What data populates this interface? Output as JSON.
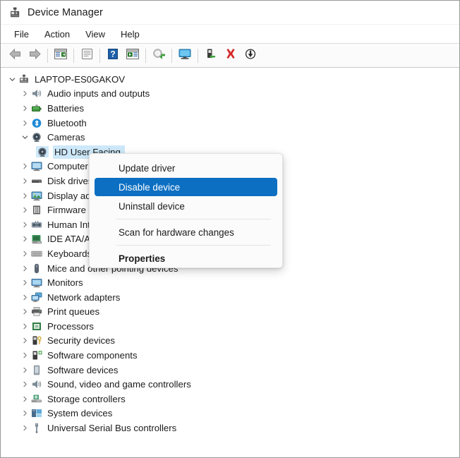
{
  "window": {
    "title": "Device Manager",
    "app_icon": "device-manager-icon"
  },
  "menubar": {
    "items": [
      {
        "label": "File",
        "name": "menu-file"
      },
      {
        "label": "Action",
        "name": "menu-action"
      },
      {
        "label": "View",
        "name": "menu-view"
      },
      {
        "label": "Help",
        "name": "menu-help"
      }
    ]
  },
  "toolbar": {
    "buttons": [
      {
        "icon": "back-arrow-icon",
        "name": "toolbar-back"
      },
      {
        "icon": "forward-arrow-icon",
        "name": "toolbar-forward"
      },
      {
        "sep": true
      },
      {
        "icon": "show-hide-console-tree-icon",
        "name": "toolbar-console-tree"
      },
      {
        "sep": true
      },
      {
        "icon": "properties-icon",
        "name": "toolbar-properties"
      },
      {
        "sep": true
      },
      {
        "icon": "help-icon",
        "name": "toolbar-help"
      },
      {
        "icon": "show-hide-action-pane-icon",
        "name": "toolbar-action-pane"
      },
      {
        "sep": true
      },
      {
        "icon": "update-driver-icon",
        "name": "toolbar-update-driver"
      },
      {
        "sep": true
      },
      {
        "icon": "scan-hardware-changes-icon",
        "name": "toolbar-scan-hardware"
      },
      {
        "sep": true
      },
      {
        "icon": "disable-device-icon",
        "name": "toolbar-disable-device"
      },
      {
        "icon": "uninstall-device-icon",
        "name": "toolbar-uninstall-device"
      },
      {
        "icon": "add-legacy-hardware-icon",
        "name": "toolbar-add-legacy-hardware"
      }
    ]
  },
  "tree": {
    "root": {
      "label": "LAPTOP-ES0GAKOV",
      "icon": "computer-icon",
      "expanded": true
    },
    "items": [
      {
        "label": "Audio inputs and outputs",
        "icon": "speaker-icon",
        "depth": 1,
        "expanded": false
      },
      {
        "label": "Batteries",
        "icon": "battery-icon",
        "depth": 1,
        "expanded": false
      },
      {
        "label": "Bluetooth",
        "icon": "bluetooth-icon",
        "depth": 1,
        "expanded": false
      },
      {
        "label": "Cameras",
        "icon": "camera-icon",
        "depth": 1,
        "expanded": true
      },
      {
        "label": "HD User Facing",
        "icon": "camera-icon",
        "depth": 2,
        "selected": true,
        "obscured": true
      },
      {
        "label": "Computer",
        "icon": "monitor-icon",
        "depth": 1,
        "expanded": false
      },
      {
        "label": "Disk drives",
        "icon": "disk-drive-icon",
        "depth": 1,
        "expanded": false
      },
      {
        "label": "Display adapters",
        "icon": "display-adapter-icon",
        "depth": 1,
        "expanded": false
      },
      {
        "label": "Firmware",
        "icon": "firmware-icon",
        "depth": 1,
        "expanded": false
      },
      {
        "label": "Human Interface Devices",
        "icon": "hid-icon",
        "depth": 1,
        "expanded": false
      },
      {
        "label": "IDE ATA/ATAPI controllers",
        "icon": "ide-controller-icon",
        "depth": 1,
        "expanded": false
      },
      {
        "label": "Keyboards",
        "icon": "keyboard-icon",
        "depth": 1,
        "expanded": false
      },
      {
        "label": "Mice and other pointing devices",
        "icon": "mouse-icon",
        "depth": 1,
        "expanded": false
      },
      {
        "label": "Monitors",
        "icon": "monitor-icon",
        "depth": 1,
        "expanded": false
      },
      {
        "label": "Network adapters",
        "icon": "network-adapter-icon",
        "depth": 1,
        "expanded": false
      },
      {
        "label": "Print queues",
        "icon": "printer-icon",
        "depth": 1,
        "expanded": false
      },
      {
        "label": "Processors",
        "icon": "processor-icon",
        "depth": 1,
        "expanded": false
      },
      {
        "label": "Security devices",
        "icon": "security-device-icon",
        "depth": 1,
        "expanded": false
      },
      {
        "label": "Software components",
        "icon": "software-component-icon",
        "depth": 1,
        "expanded": false
      },
      {
        "label": "Software devices",
        "icon": "software-device-icon",
        "depth": 1,
        "expanded": false
      },
      {
        "label": "Sound, video and game controllers",
        "icon": "sound-controller-icon",
        "depth": 1,
        "expanded": false
      },
      {
        "label": "Storage controllers",
        "icon": "storage-controller-icon",
        "depth": 1,
        "expanded": false
      },
      {
        "label": "System devices",
        "icon": "system-device-icon",
        "depth": 1,
        "expanded": false
      },
      {
        "label": "Universal Serial Bus controllers",
        "icon": "usb-controller-icon",
        "depth": 1,
        "expanded": false
      }
    ]
  },
  "context_menu": {
    "items": [
      {
        "label": "Update driver",
        "name": "ctx-update-driver",
        "highlight": false,
        "bold": false
      },
      {
        "label": "Disable device",
        "name": "ctx-disable-device",
        "highlight": true,
        "bold": false
      },
      {
        "label": "Uninstall device",
        "name": "ctx-uninstall-device",
        "highlight": false,
        "bold": false
      },
      {
        "sep": true
      },
      {
        "label": "Scan for hardware changes",
        "name": "ctx-scan-hardware-changes",
        "highlight": false,
        "bold": false
      },
      {
        "sep": true
      },
      {
        "label": "Properties",
        "name": "ctx-properties",
        "highlight": false,
        "bold": true
      }
    ]
  },
  "colors": {
    "menu_highlight": "#0c6fc2",
    "tree_selection": "#cde8f9",
    "text": "#1b1b1b"
  }
}
